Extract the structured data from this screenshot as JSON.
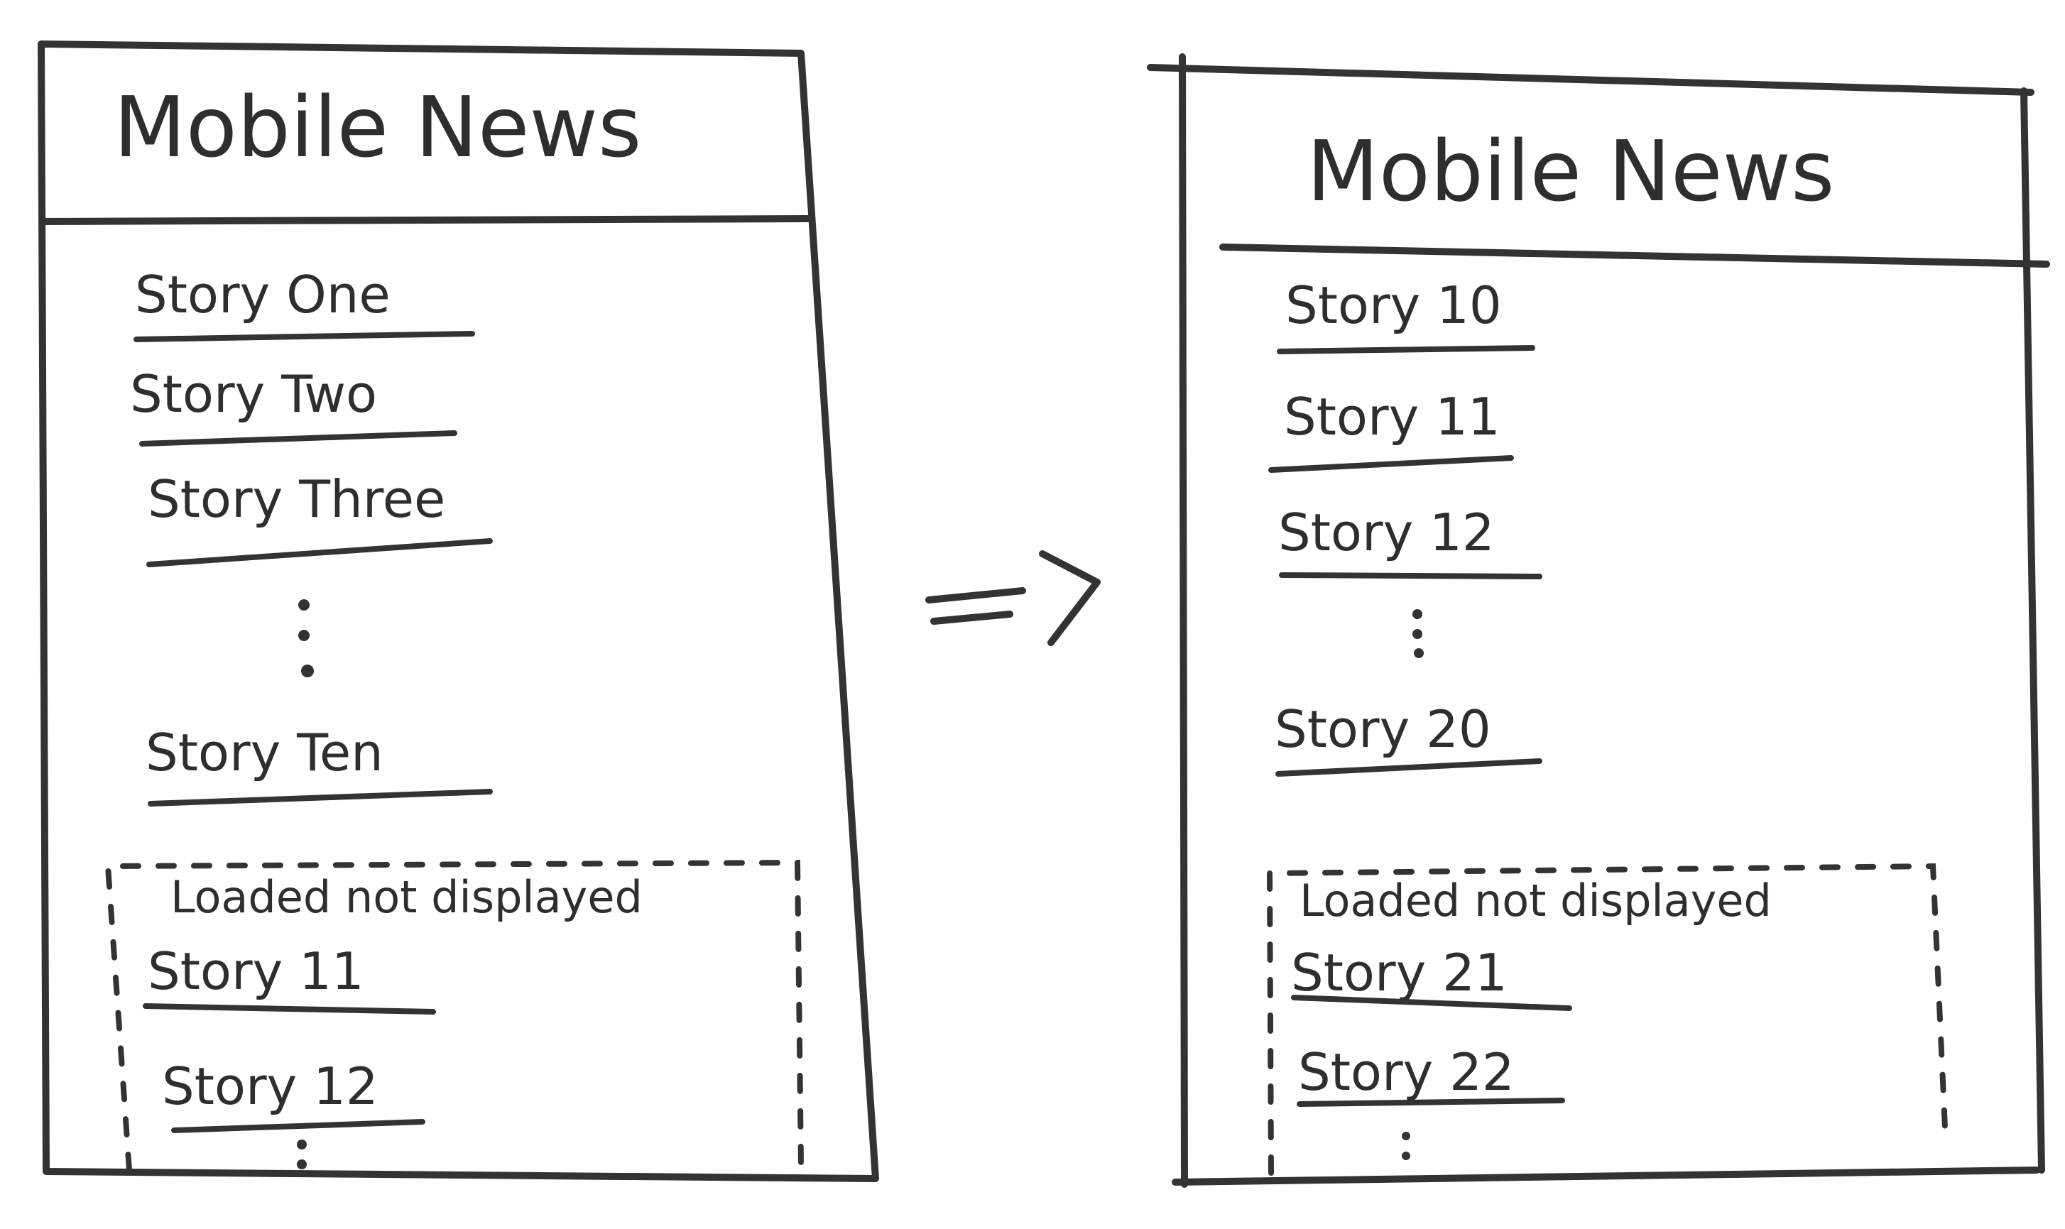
{
  "left_phone": {
    "title": "Mobile News",
    "visible_stories": [
      "Story One",
      "Story Two",
      "Story Three",
      "Story Ten"
    ],
    "buffer_label": "Loaded not displayed",
    "buffered_stories": [
      "Story 11",
      "Story 12"
    ]
  },
  "transition_arrow": "=>",
  "right_phone": {
    "title": "Mobile News",
    "visible_stories": [
      "Story 10",
      "Story 11",
      "Story 12",
      "Story 20"
    ],
    "buffer_label": "Loaded not displayed",
    "buffered_stories": [
      "Story 21",
      "Story 22"
    ]
  }
}
